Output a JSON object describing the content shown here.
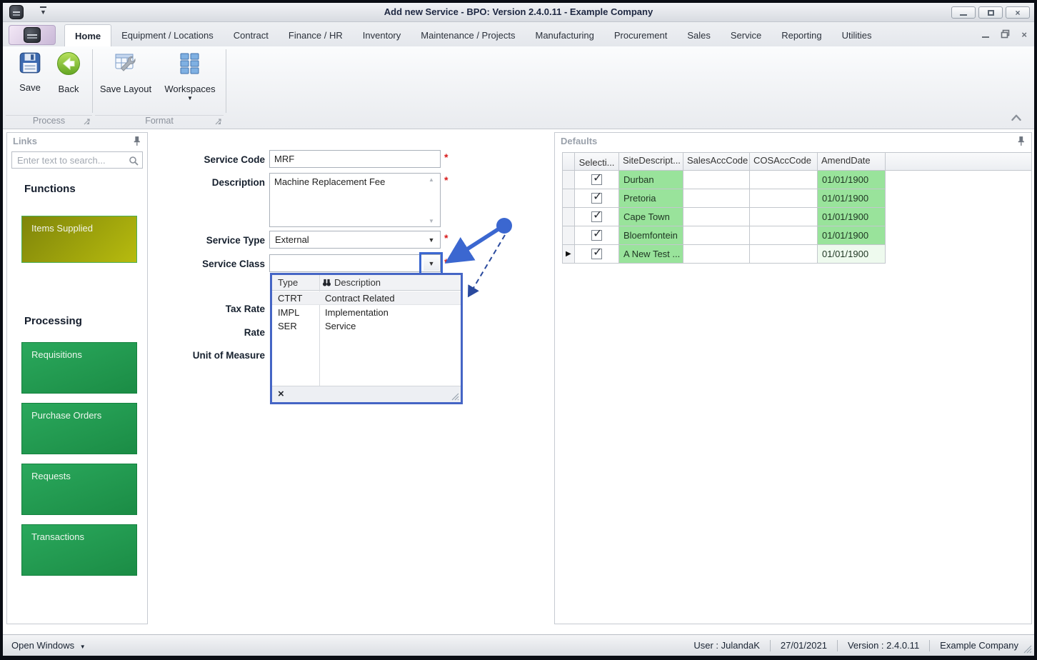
{
  "window": {
    "title": "Add new Service - BPO: Version 2.4.0.11 - Example Company"
  },
  "icons": {
    "qat_arrow": "▼",
    "window_close": "×",
    "dropdown_arrow": "▼",
    "scroll_up": "▲",
    "scroll_down": "▼",
    "workspaces_arrow": "▼",
    "open_windows_arrow": "▼",
    "checkbox_check": "✓",
    "row_indicator": "▶",
    "clear_x": "×",
    "mdi_minimize": "–",
    "mdi_close": "×"
  },
  "ribbon": {
    "tabs": [
      "Home",
      "Equipment / Locations",
      "Contract",
      "Finance / HR",
      "Inventory",
      "Maintenance / Projects",
      "Manufacturing",
      "Procurement",
      "Sales",
      "Service",
      "Reporting",
      "Utilities"
    ],
    "buttons": {
      "save": "Save",
      "back": "Back",
      "save_layout": "Save Layout",
      "workspaces": "Workspaces"
    },
    "groups": {
      "process": "Process",
      "format": "Format"
    }
  },
  "links_panel": {
    "title": "Links",
    "search_placeholder": "Enter text to search...",
    "functions_heading": "Functions",
    "items_supplied": "Items Supplied",
    "processing_heading": "Processing",
    "processing_items": [
      "Requisitions",
      "Purchase Orders",
      "Requests",
      "Transactions"
    ]
  },
  "form": {
    "required_marker": "*",
    "service_code": {
      "label": "Service Code",
      "value": "MRF"
    },
    "description": {
      "label": "Description",
      "value": "Machine Replacement Fee"
    },
    "service_type": {
      "label": "Service Type",
      "value": "External"
    },
    "service_class": {
      "label": "Service Class",
      "value": ""
    },
    "tax_rate_label": "Tax Rate",
    "rate_label": "Rate",
    "unit_of_measure_label": "Unit of Measure"
  },
  "service_class_popup": {
    "col_type": "Type",
    "col_description": "Description",
    "rows": [
      {
        "type": "CTRT",
        "description": "Contract Related"
      },
      {
        "type": "IMPL",
        "description": "Implementation"
      },
      {
        "type": "SER",
        "description": "Service"
      }
    ]
  },
  "defaults_panel": {
    "title": "Defaults",
    "columns": {
      "selection": "Selecti...",
      "site": "SiteDescript...",
      "sales": "SalesAccCode",
      "cos": "COSAccCode",
      "amend": "AmendDate"
    },
    "rows": [
      {
        "check": "✓",
        "site": "Durban",
        "sales": "",
        "cos": "",
        "amend": "01/01/1900"
      },
      {
        "check": "✓",
        "site": "Pretoria",
        "sales": "",
        "cos": "",
        "amend": "01/01/1900"
      },
      {
        "check": "✓",
        "site": "Cape Town",
        "sales": "",
        "cos": "",
        "amend": "01/01/1900"
      },
      {
        "check": "✓",
        "site": "Bloemfontein",
        "sales": "",
        "cos": "",
        "amend": "01/01/1900"
      },
      {
        "check": "✓",
        "site": "A New Test ...",
        "sales": "",
        "cos": "",
        "amend": "01/01/1900"
      }
    ]
  },
  "status_bar": {
    "open_windows": "Open Windows",
    "user": "User : JulandaK",
    "date": "27/01/2021",
    "version": "Version : 2.4.0.11",
    "company": "Example Company"
  },
  "colors": {
    "annotation_blue": "#3b67d0",
    "popup_border_blue": "#4565c5",
    "grid_green": "#99e39b",
    "tile_green": "#22a054",
    "tile_olive": "#9aa005",
    "required_red": "#d81a1a"
  }
}
